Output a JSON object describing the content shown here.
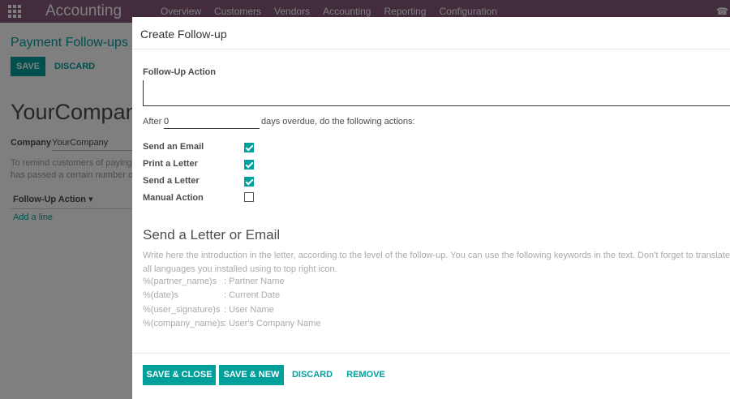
{
  "navbar": {
    "brand": "Accounting",
    "menu": [
      "Overview",
      "Customers",
      "Vendors",
      "Accounting",
      "Reporting",
      "Configuration"
    ]
  },
  "background": {
    "breadcrumb": "Payment Follow-ups /",
    "save_label": "SAVE",
    "discard_label": "DISCARD",
    "title": "YourCompan",
    "company_label": "Company",
    "company_value": "YourCompany",
    "help_line1": "To remind customers of paying",
    "help_line2": "has passed a certain number of",
    "column_header": "Follow-Up Action ▾",
    "add_line": "Add a line"
  },
  "modal": {
    "title": "Create Follow-up",
    "field_label": "Follow-Up Action",
    "name_value": "",
    "after_label": "After",
    "days_value": "0",
    "after_suffix": "days overdue, do the following actions:",
    "options": [
      {
        "label": "Send an Email",
        "checked": true
      },
      {
        "label": "Print a Letter",
        "checked": true
      },
      {
        "label": "Send a Letter",
        "checked": true
      },
      {
        "label": "Manual Action",
        "checked": false
      }
    ],
    "section_title": "Send a Letter or Email",
    "description_line1": "Write here the introduction in the letter, according to the level of the follow-up. You can use the following keywords in the text. Don't forget to translate in",
    "description_line2": "all languages you installed using to top right icon.",
    "keywords": [
      {
        "key": "%(partner_name)s",
        "value": ": Partner Name"
      },
      {
        "key": "%(date)s",
        "value": ": Current Date"
      },
      {
        "key": "%(user_signature)s",
        "value": ": User Name"
      },
      {
        "key": "%(company_name)s",
        "value": ": User's Company Name"
      }
    ],
    "buttons": {
      "save_close": "SAVE & CLOSE",
      "save_new": "SAVE & NEW",
      "discard": "DISCARD",
      "remove": "REMOVE"
    }
  },
  "colors": {
    "navbar": "#875a7b",
    "accent": "#00a09d"
  }
}
